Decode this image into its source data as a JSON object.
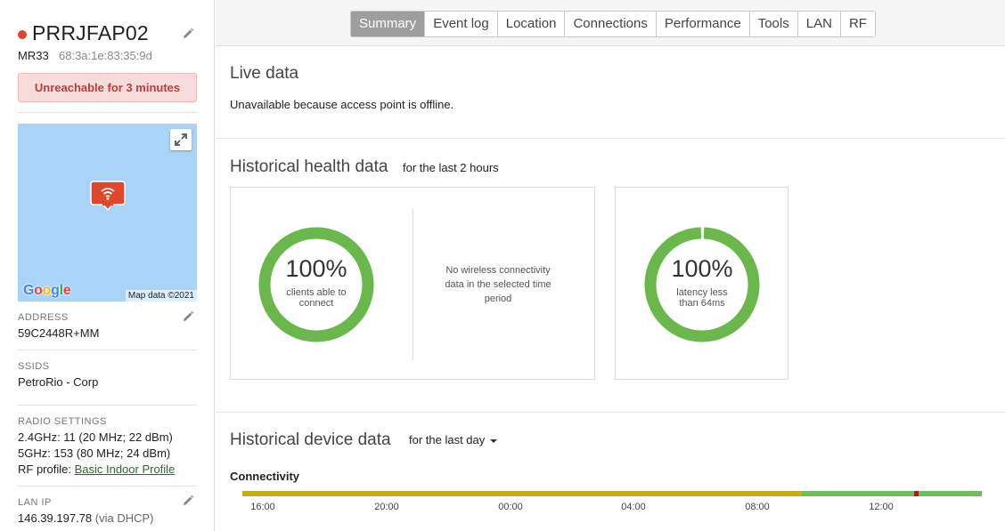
{
  "device": {
    "name": "PRRJFAP02",
    "model": "MR33",
    "mac": "68:3a:1e:83:35:9d",
    "status_color": "#e0462a",
    "alert": "Unreachable for 3 minutes"
  },
  "map": {
    "attribution_brand": "Google",
    "copyright": "Map data ©2021",
    "expand_icon": "expand-icon",
    "marker_icon": "wifi-icon"
  },
  "address": {
    "label": "ADDRESS",
    "value": "59C2448R+MM"
  },
  "ssids": {
    "label": "SSIDS",
    "value": "PetroRio - Corp"
  },
  "radio": {
    "label": "RADIO SETTINGS",
    "band_24": "2.4GHz: 11 (20 MHz; 22 dBm)",
    "band_5": "5GHz: 153 (80 MHz; 24 dBm)",
    "rf_profile_label": "RF profile: ",
    "rf_profile_link": "Basic Indoor Profile"
  },
  "lan_ip": {
    "label": "LAN IP",
    "ip": "146.39.197.78",
    "via": "(via DHCP)"
  },
  "tabs": [
    {
      "label": "Summary",
      "active": true
    },
    {
      "label": "Event log"
    },
    {
      "label": "Location"
    },
    {
      "label": "Connections"
    },
    {
      "label": "Performance"
    },
    {
      "label": "Tools"
    },
    {
      "label": "LAN"
    },
    {
      "label": "RF"
    }
  ],
  "live": {
    "title": "Live data",
    "message": "Unavailable because access point is offline."
  },
  "health": {
    "title": "Historical health data",
    "range": "for the last 2 hours",
    "clients": {
      "percent_label": "100%",
      "percent": 100,
      "caption": "clients able to connect"
    },
    "no_data": "No wireless connectivity data in the selected time period",
    "latency": {
      "percent_label": "100%",
      "percent": 99,
      "caption": "latency less than 64ms"
    },
    "ring_color": "#6ab84b"
  },
  "device_data": {
    "title": "Historical device data",
    "range": "for the last day",
    "connectivity_label": "Connectivity",
    "ticks": [
      "16:00",
      "20:00",
      "00:00",
      "04:00",
      "08:00",
      "12:00"
    ],
    "colors": {
      "partial": "#c9a914",
      "online": "#6dbf5e",
      "offline": "#a51d1d"
    },
    "segments": [
      {
        "state": "partial",
        "from": 0.0,
        "to": 0.757
      },
      {
        "state": "online",
        "from": 0.757,
        "to": 0.909
      },
      {
        "state": "offline",
        "from": 0.909,
        "to": 0.914
      },
      {
        "state": "online",
        "from": 0.914,
        "to": 1.0
      }
    ]
  }
}
